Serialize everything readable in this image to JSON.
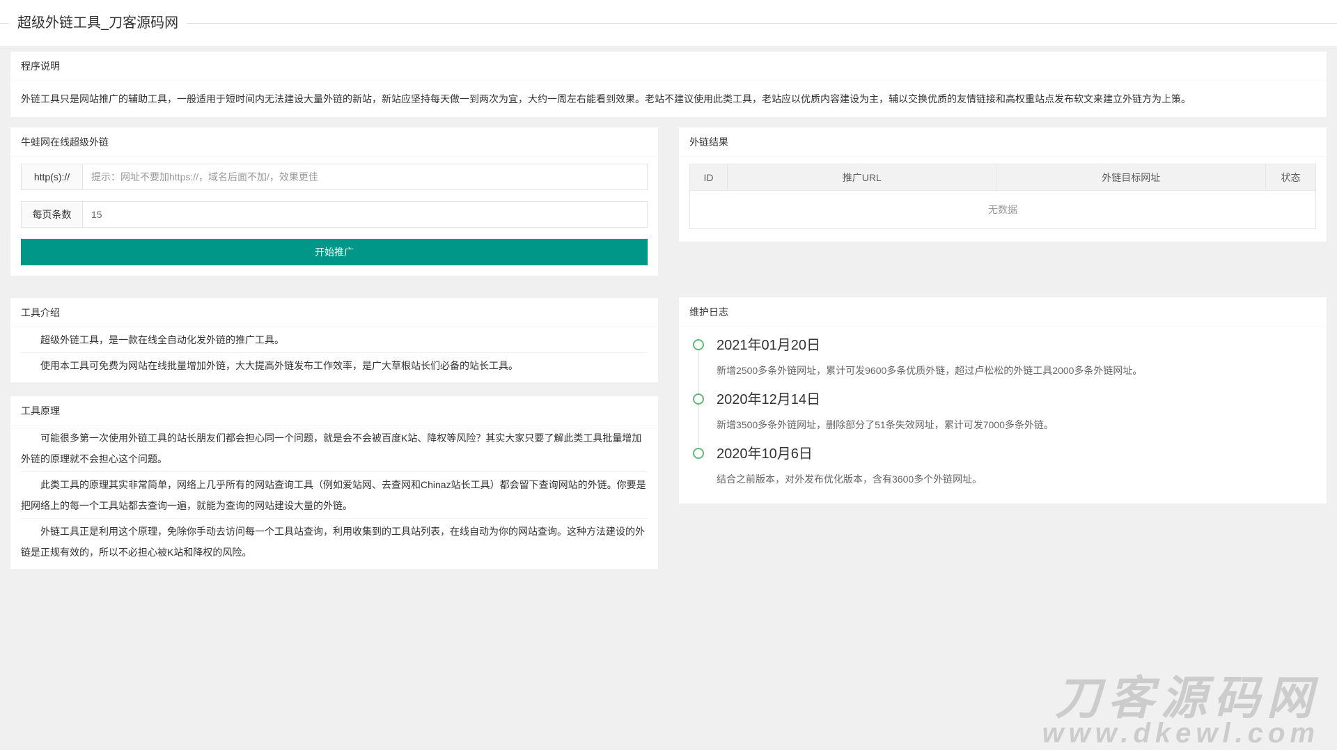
{
  "page": {
    "title": "超级外链工具_刀客源码网",
    "background_color": "#f0f0f0",
    "accent_color": "#009688",
    "timeline_dot_color": "#5FB878"
  },
  "notice": {
    "title": "程序说明",
    "body": "外链工具只是网站推广的辅助工具，一般适用于短时间内无法建设大量外链的新站，新站应坚持每天做一到两次为宜，大约一周左右能看到效果。老站不建议使用此类工具，老站应以优质内容建设为主，辅以交换优质的友情链接和高权重站点发布软文来建立外链方为上策。"
  },
  "form_card": {
    "title": "牛蛙网在线超级外链",
    "url_label": "http(s)://",
    "url_placeholder": "提示：网址不要加https://，域名后面不加/，效果更佳",
    "url_value": "",
    "per_page_label": "每页条数",
    "per_page_value": "15",
    "submit_label": "开始推广"
  },
  "results_card": {
    "title": "外链结果",
    "columns": [
      "ID",
      "推广URL",
      "外链目标网址",
      "状态"
    ],
    "empty_text": "无数据"
  },
  "intro_card": {
    "title": "工具介绍",
    "items": [
      "超级外链工具，是一款在线全自动化发外链的推广工具。",
      "使用本工具可免费为网站在线批量增加外链，大大提高外链发布工作效率，是广大草根站长们必备的站长工具。"
    ]
  },
  "principle_card": {
    "title": "工具原理",
    "items": [
      "可能很多第一次使用外链工具的站长朋友们都会担心同一个问题，就是会不会被百度K站、降权等风险？其实大家只要了解此类工具批量增加外链的原理就不会担心这个问题。",
      "此类工具的原理其实非常简单，网络上几乎所有的网站查询工具（例如爱站网、去查网和Chinaz站长工具）都会留下查询网站的外链。你要是把网络上的每一个工具站都去查询一遍，就能为查询的网站建设大量的外链。",
      "外链工具正是利用这个原理，免除你手动去访问每一个工具站查询，利用收集到的工具站列表，在线自动为你的网站查询。这种方法建设的外链是正规有效的，所以不必担心被K站和降权的风险。"
    ]
  },
  "log_card": {
    "title": "维护日志",
    "entries": [
      {
        "date": "2021年01月20日",
        "desc": "新增2500多条外链网址，累计可发9600多条优质外链，超过卢松松的外链工具2000多条外链网址。"
      },
      {
        "date": "2020年12月14日",
        "desc": "新增3500多条外链网址，删除部分了51条失效网址，累计可发7000多条外链。"
      },
      {
        "date": "2020年10月6日",
        "desc": "结合之前版本，对外发布优化版本，含有3600多个外链网址。"
      }
    ]
  },
  "watermark": {
    "line1": "刀客源码网",
    "line2": "www.dkewl.com"
  }
}
